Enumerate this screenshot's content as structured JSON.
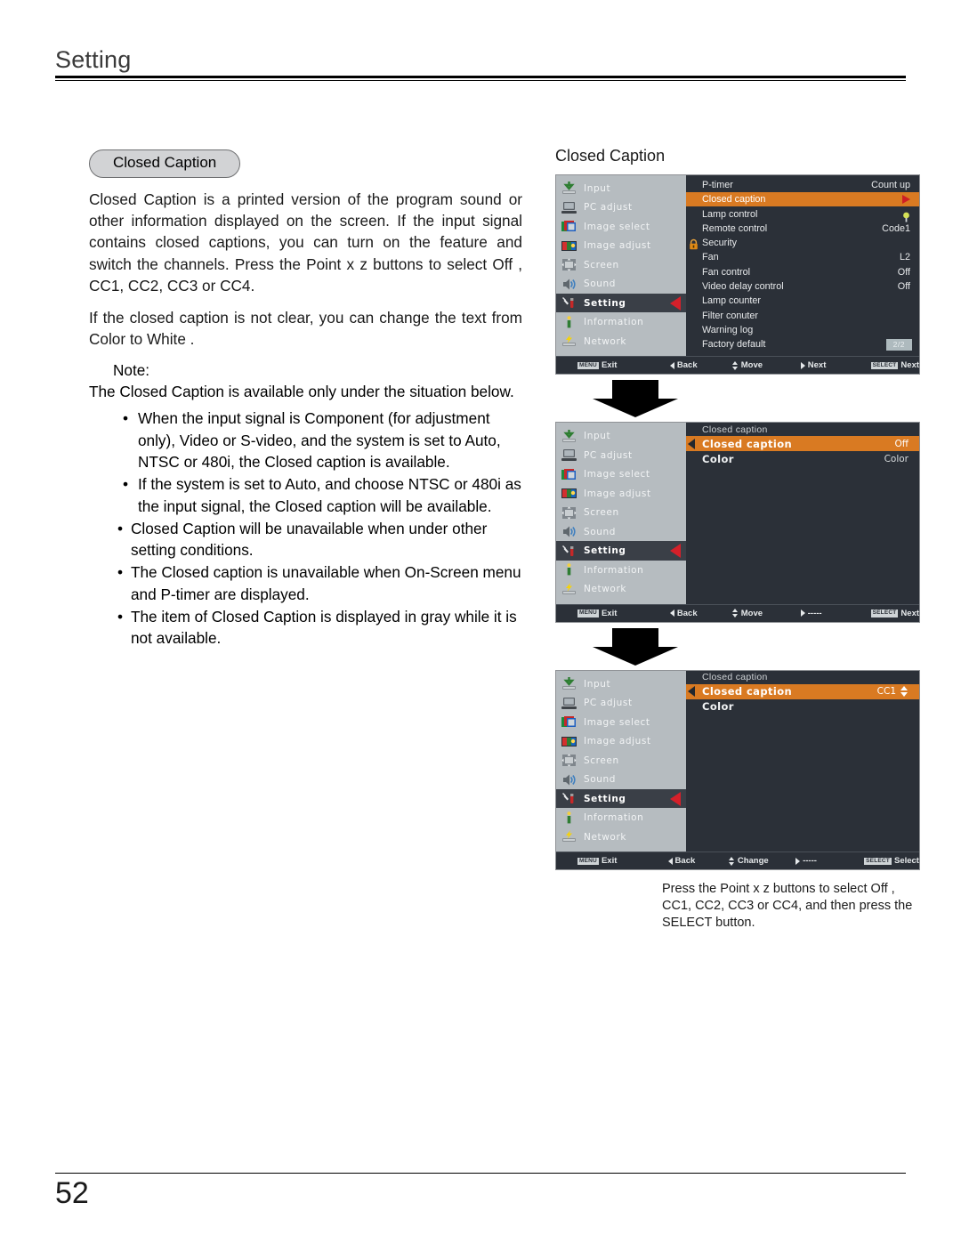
{
  "page": {
    "header_title": "Setting",
    "page_number": "52"
  },
  "left": {
    "pill_label": "Closed Caption",
    "paragraph1": "Closed Caption is a printed version of the program sound or other information displayed on the screen. If the input signal contains closed captions, you can turn on the feature and switch the channels. Press the Point  x z  buttons to select Off , CC1, CC2, CC3 or CC4.",
    "paragraph2": "If the closed caption is not clear, you can change the text from Color  to White .",
    "note_label": "Note:",
    "note_body": "The Closed Caption is available only under the situation below.",
    "bullets": [
      "When the input signal is Component (for adjustment only),  Video or  S-video, and the system is set to Auto, NTSC or 480i, the Closed caption is available.",
      "If  the system is set to Auto, and choose NTSC or 480i as the input signal, the Closed caption will be available.",
      "Closed Caption will be unavailable when under other setting conditions.",
      "The Closed caption is unavailable when On-Screen menu and P-timer are displayed.",
      "The item of Closed Caption is displayed in gray while it is not available."
    ]
  },
  "right": {
    "title": "Closed Caption",
    "caption": "Press the Point  x z  buttons to select Off , CC1, CC2, CC3 or CC4, and then press the SELECT button.",
    "sidebar": [
      {
        "label": "Input",
        "icon": "input-icon",
        "active": false
      },
      {
        "label": "PC adjust",
        "icon": "pc-adjust-icon",
        "active": false
      },
      {
        "label": "Image select",
        "icon": "image-select-icon",
        "active": false
      },
      {
        "label": "Image adjust",
        "icon": "image-adjust-icon",
        "active": false
      },
      {
        "label": "Screen",
        "icon": "screen-icon",
        "active": false
      },
      {
        "label": "Sound",
        "icon": "sound-icon",
        "active": false
      },
      {
        "label": "Setting",
        "icon": "setting-icon",
        "active": true
      },
      {
        "label": "Information",
        "icon": "information-icon",
        "active": false
      },
      {
        "label": "Network",
        "icon": "network-icon",
        "active": false
      }
    ],
    "osd1": {
      "rows": [
        {
          "name": "P-timer",
          "value": "Count up",
          "highlight": false,
          "kind": "text"
        },
        {
          "name": "Closed caption",
          "value": "",
          "highlight": true,
          "kind": "arrow"
        },
        {
          "name": "Lamp control",
          "value": "",
          "highlight": false,
          "kind": "bulb"
        },
        {
          "name": "Remote control",
          "value": "Code1",
          "highlight": false,
          "kind": "text"
        },
        {
          "name": "Security",
          "value": "",
          "highlight": false,
          "kind": "lock"
        },
        {
          "name": "Fan",
          "value": "L2",
          "highlight": false,
          "kind": "text"
        },
        {
          "name": "Fan control",
          "value": "Off",
          "highlight": false,
          "kind": "text"
        },
        {
          "name": " Video delay control",
          "value": "Off",
          "highlight": false,
          "kind": "text"
        },
        {
          "name": "Lamp counter",
          "value": "",
          "highlight": false,
          "kind": "text"
        },
        {
          "name": "Filter conuter",
          "value": "",
          "highlight": false,
          "kind": "text"
        },
        {
          "name": "Warning log",
          "value": "",
          "highlight": false,
          "kind": "text"
        },
        {
          "name": "Factory default",
          "value": "",
          "highlight": false,
          "kind": "text"
        }
      ],
      "page_badge": "2/2",
      "bar": {
        "exit_key": "MENU",
        "exit_label": "Exit",
        "back_label": "Back",
        "move_label": "Move",
        "next_label": "Next",
        "select_key": "SELECT",
        "select_label": "Next"
      }
    },
    "osd2": {
      "heading": "Closed caption",
      "rows": [
        {
          "name": "Closed caption",
          "value": "Off",
          "highlight": true,
          "stepper": false
        },
        {
          "name": "Color",
          "value": "Color",
          "highlight": false,
          "stepper": false
        }
      ],
      "bar": {
        "exit_key": "MENU",
        "exit_label": "Exit",
        "back_label": "Back",
        "move_label": "Move",
        "next_label": "-----",
        "select_key": "SELECT",
        "select_label": "Next"
      }
    },
    "osd3": {
      "heading": "Closed caption",
      "rows": [
        {
          "name": "Closed caption",
          "value": "CC1",
          "highlight": true,
          "stepper": true
        },
        {
          "name": "Color",
          "value": "",
          "highlight": false,
          "stepper": false
        }
      ],
      "bar": {
        "exit_key": "MENU",
        "exit_label": "Exit",
        "back_label": "Back",
        "move_label": "Change",
        "next_label": "-----",
        "select_key": "SELECT",
        "select_label": "Select"
      }
    }
  },
  "colors": {
    "highlight_orange": "#d97a22",
    "osd_dark": "#2b3038",
    "osd_sidebar": "#b6bcc0",
    "red_arrow": "#cf1f25",
    "pill_fill": "#d2d3d5"
  }
}
